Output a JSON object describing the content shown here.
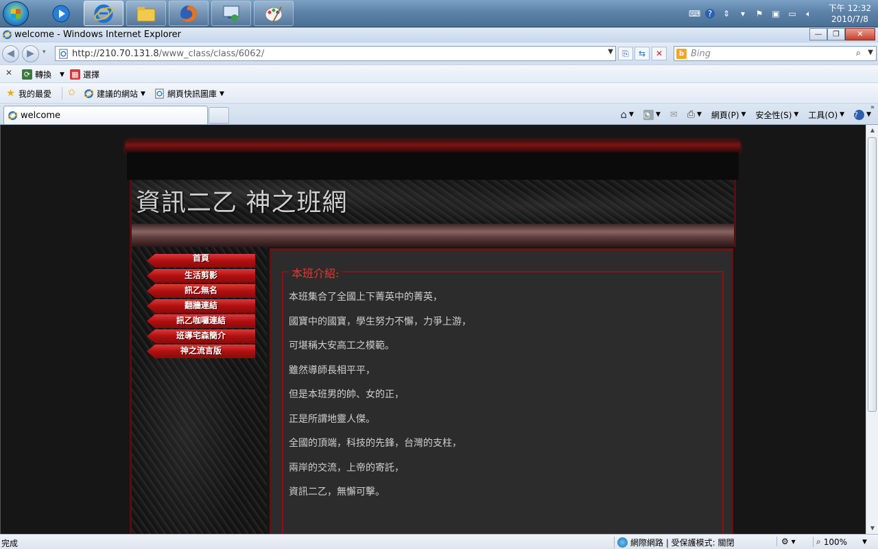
{
  "taskbar": {
    "clock_time": "下午 12:32",
    "clock_date": "2010/7/8"
  },
  "window": {
    "title": "welcome - Windows Internet Explorer",
    "minimize": "—",
    "maximize": "❐",
    "close": "✕"
  },
  "nav": {
    "url_host": "http://210.70.131.8",
    "url_path": "/www_class/class/6062/",
    "search_placeholder": "Bing"
  },
  "command_bar": {
    "close": "✕",
    "convert": "轉換",
    "select": "選擇"
  },
  "favorites_bar": {
    "favorites": "我的最愛",
    "suggested_sites": "建議的網站",
    "web_slice_gallery": "網頁快訊圖庫"
  },
  "tab": {
    "title": "welcome"
  },
  "tools": {
    "page": "網頁(P)",
    "safety": "安全性(S)",
    "tools": "工具(O)"
  },
  "site": {
    "title": "資訊二乙 神之班網",
    "menu": [
      "首頁",
      "生活剪影",
      "訊乙無名",
      "翻牆連結",
      "訊乙咖囉連結",
      "班導宅森簡介",
      "神之流言版"
    ],
    "section_title": "本班介紹:",
    "intro_lines": [
      "本班集合了全國上下菁英中的菁英，",
      "國寶中的國寶，學生努力不懈，力爭上游，",
      "可堪稱大安高工之模範。",
      "雖然導師長相平平，",
      "但是本班男的帥、女的正，",
      "正是所謂地靈人傑。",
      "全國的頂端，科技的先鋒，台灣的支柱，",
      "兩岸的交流，上帝的寄託，",
      "資訊二乙，無懈可擊。"
    ]
  },
  "status": {
    "left": "完成",
    "zone": "網際網路 | 受保護模式: 關閉",
    "zoom": "100%"
  }
}
